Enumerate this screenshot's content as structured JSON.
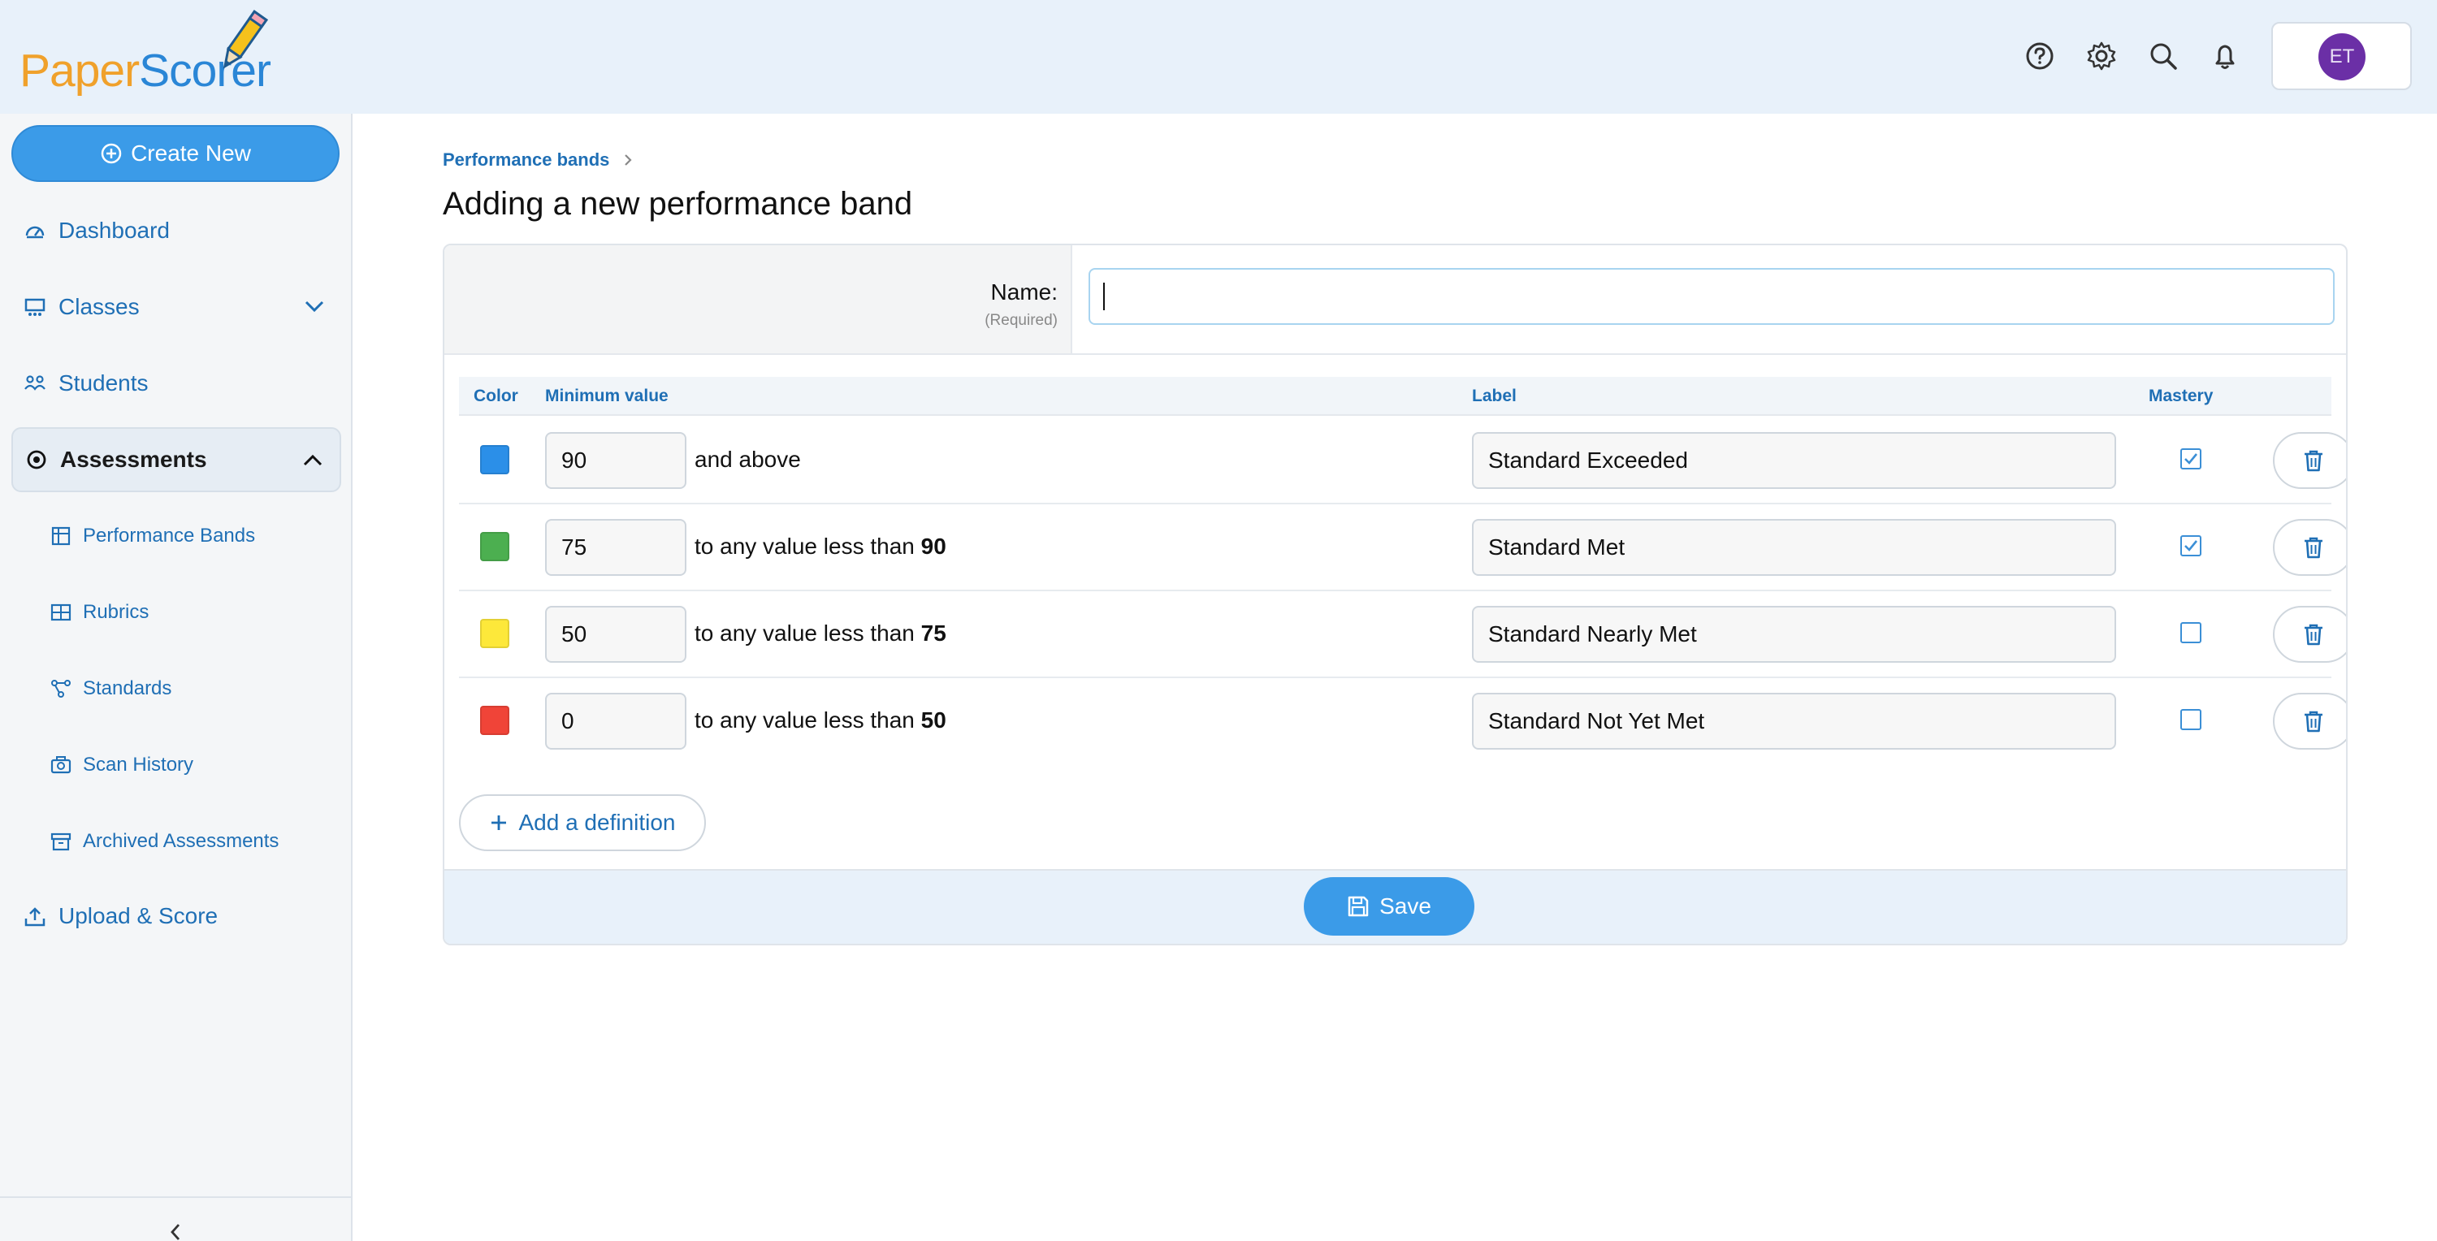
{
  "app": {
    "logo_part1": "Paper",
    "logo_part2": "Scorer",
    "user_initials": "ET",
    "colors": {
      "primary": "#3b9be8",
      "link": "#1f6fb5",
      "brand_orange": "#f0a12b",
      "avatar": "#6b2fa6"
    }
  },
  "header": {
    "icons": [
      "help-icon",
      "settings-icon",
      "search-icon",
      "bell-icon"
    ]
  },
  "sidebar": {
    "create_label": "Create New",
    "items": [
      {
        "label": "Dashboard",
        "icon": "dashboard-icon"
      },
      {
        "label": "Classes",
        "icon": "classes-icon",
        "expandable": true,
        "expanded": false
      },
      {
        "label": "Students",
        "icon": "students-icon"
      },
      {
        "label": "Assessments",
        "icon": "assessments-icon",
        "expandable": true,
        "expanded": true,
        "active": true
      },
      {
        "label": "Upload & Score",
        "icon": "upload-icon"
      }
    ],
    "sub_items": [
      {
        "label": "Performance Bands",
        "icon": "performance-bands-icon"
      },
      {
        "label": "Rubrics",
        "icon": "rubrics-icon"
      },
      {
        "label": "Standards",
        "icon": "standards-icon"
      },
      {
        "label": "Scan History",
        "icon": "camera-icon"
      },
      {
        "label": "Archived Assessments",
        "icon": "archive-icon"
      }
    ]
  },
  "breadcrumb": {
    "parent": "Performance bands"
  },
  "page": {
    "title": "Adding a new performance band"
  },
  "form": {
    "name_label": "Name:",
    "name_required": "(Required)",
    "name_value": "",
    "columns": {
      "color": "Color",
      "minimum": "Minimum value",
      "label": "Label",
      "mastery": "Mastery"
    },
    "bands": [
      {
        "color": "#2b8fe8",
        "min": "90",
        "range_prefix": "and above",
        "range_bound": "",
        "label": "Standard Exceeded",
        "mastery": true
      },
      {
        "color": "#4caf50",
        "min": "75",
        "range_prefix": "to any value less than",
        "range_bound": "90",
        "label": "Standard Met",
        "mastery": true
      },
      {
        "color": "#fde83a",
        "min": "50",
        "range_prefix": "to any value less than",
        "range_bound": "75",
        "label": "Standard Nearly Met",
        "mastery": false
      },
      {
        "color": "#f04438",
        "min": "0",
        "range_prefix": "to any value less than",
        "range_bound": "50",
        "label": "Standard Not Yet Met",
        "mastery": false
      }
    ],
    "add_label": "Add a definition",
    "save_label": "Save"
  }
}
